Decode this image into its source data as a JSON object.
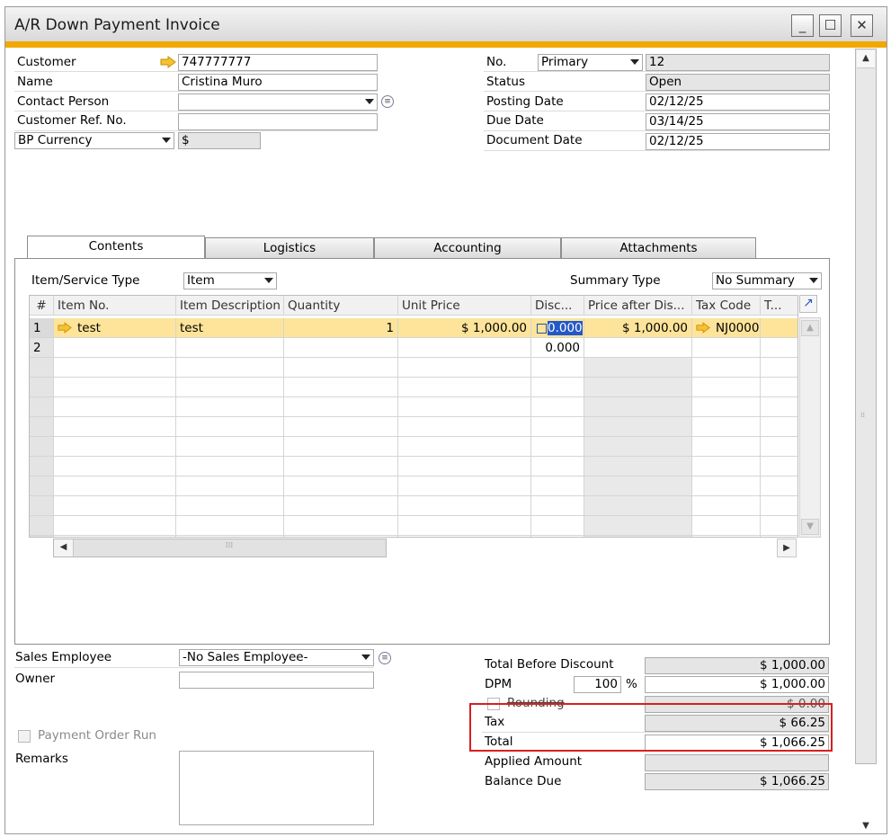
{
  "window": {
    "title": "A/R Down Payment Invoice"
  },
  "header_left": {
    "customer_label": "Customer",
    "customer_value": "747777777",
    "name_label": "Name",
    "name_value": "Cristina Muro",
    "contact_label": "Contact Person",
    "contact_value": "",
    "custref_label": "Customer Ref. No.",
    "custref_value": "",
    "currency_select": "BP Currency",
    "currency_value": "$"
  },
  "header_right": {
    "no_label": "No.",
    "series_select": "Primary",
    "no_value": "12",
    "status_label": "Status",
    "status_value": "Open",
    "posting_label": "Posting Date",
    "posting_value": "02/12/25",
    "due_label": "Due Date",
    "due_value": "03/14/25",
    "docdate_label": "Document Date",
    "docdate_value": "02/12/25"
  },
  "tabs": [
    "Contents",
    "Logistics",
    "Accounting",
    "Attachments"
  ],
  "contents": {
    "item_type_label": "Item/Service Type",
    "item_type_value": "Item",
    "summary_label": "Summary Type",
    "summary_value": "No Summary"
  },
  "grid": {
    "columns": [
      "#",
      "Item No.",
      "Item Description",
      "Quantity",
      "Unit Price",
      "Disc...",
      "Price after Dis...",
      "Tax Code",
      "T..."
    ],
    "rows": [
      {
        "num": "1",
        "item_no": "test",
        "description": "test",
        "quantity": "1",
        "unit_price": "$ 1,000.00",
        "discount": "0.000",
        "price_after": "$ 1,000.00",
        "tax_code": "NJ0000"
      },
      {
        "num": "2",
        "item_no": "",
        "description": "",
        "quantity": "",
        "unit_price": "",
        "discount": "0.000",
        "price_after": "",
        "tax_code": ""
      }
    ]
  },
  "footer_left": {
    "sales_emp_label": "Sales Employee",
    "sales_emp_value": "-No Sales Employee-",
    "owner_label": "Owner",
    "owner_value": "",
    "payment_order_label": "Payment Order Run",
    "remarks_label": "Remarks"
  },
  "totals": {
    "before_discount_label": "Total Before Discount",
    "before_discount_value": "$ 1,000.00",
    "dpm_label": "DPM",
    "dpm_percent": "100",
    "percent_sign": "%",
    "dpm_value": "$ 1,000.00",
    "rounding_label": "Rounding",
    "rounding_value": "$ 0.00",
    "tax_label": "Tax",
    "tax_value": "$ 66.25",
    "total_label": "Total",
    "total_value": "$ 1,066.25",
    "applied_label": "Applied Amount",
    "applied_value": "",
    "balance_label": "Balance Due",
    "balance_value": "$ 1,066.25"
  },
  "colors": {
    "accent": "#f1a800",
    "selected_row": "#fde49a",
    "highlight_box": "#d62020"
  },
  "icons": [
    "link-arrow-icon",
    "dropdown-arrow-icon",
    "choose-list-icon",
    "minimize-icon",
    "maximize-icon",
    "close-icon",
    "expand-grid-icon",
    "scroll-up-icon",
    "scroll-down-icon",
    "scroll-left-icon",
    "scroll-right-icon"
  ]
}
